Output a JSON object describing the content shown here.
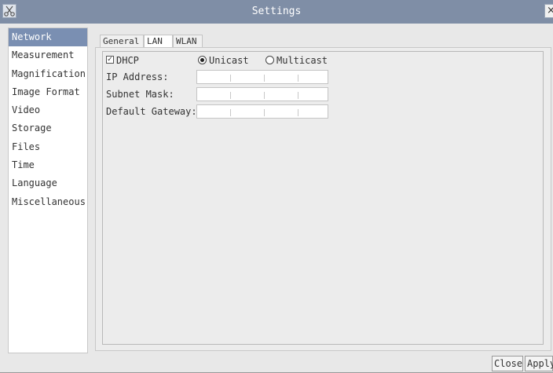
{
  "window": {
    "title": "Settings",
    "close_glyph": "×",
    "app_icon": "scissors-icon"
  },
  "sidebar": {
    "items": [
      {
        "label": "Network",
        "active": true
      },
      {
        "label": "Measurement"
      },
      {
        "label": "Magnification"
      },
      {
        "label": "Image Format"
      },
      {
        "label": "Video"
      },
      {
        "label": "Storage"
      },
      {
        "label": "Files"
      },
      {
        "label": "Time"
      },
      {
        "label": "Language"
      },
      {
        "label": "Miscellaneous"
      }
    ]
  },
  "tabs": [
    {
      "label": "General"
    },
    {
      "label": "LAN",
      "active": true
    },
    {
      "label": "WLAN"
    }
  ],
  "lan": {
    "dhcp_label": "DHCP",
    "dhcp_checked": true,
    "dhcp_glyph": "✓",
    "unicast_label": "Unicast",
    "unicast_selected": true,
    "multicast_label": "Multicast",
    "multicast_selected": false,
    "ip_label": "IP Address:",
    "subnet_label": "Subnet Mask:",
    "gateway_label": "Default Gateway:",
    "ip_value": [
      "",
      "",
      "",
      ""
    ],
    "subnet_value": [
      "",
      "",
      "",
      ""
    ],
    "gateway_value": [
      "",
      "",
      "",
      ""
    ]
  },
  "buttons": {
    "close": "Close",
    "apply": "Apply"
  },
  "colors": {
    "titlebar": "#7f8ea6",
    "selection": "#7a8fb2"
  }
}
